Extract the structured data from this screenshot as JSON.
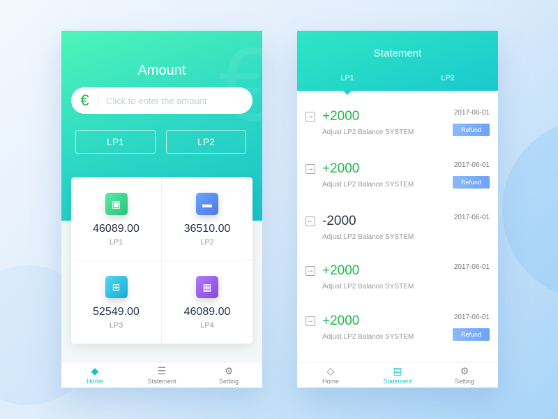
{
  "home": {
    "title": "Amount",
    "input_placeholder": "Click to enter the amount",
    "currency_symbol": "€",
    "buttons": [
      "LP1",
      "LP2"
    ],
    "accounts": [
      {
        "value": "46089.00",
        "label": "LP1"
      },
      {
        "value": "36510.00",
        "label": "LP2"
      },
      {
        "value": "52549.00",
        "label": "LP3"
      },
      {
        "value": "46089.00",
        "label": "LP4"
      }
    ]
  },
  "statement": {
    "title": "Statement",
    "tabs": [
      "LP1",
      "LP2"
    ],
    "rows": [
      {
        "amount": "+2000",
        "desc": "Adjust LP2 Balance SYSTEM",
        "date": "2017-06-01",
        "refund": "Refund"
      },
      {
        "amount": "+2000",
        "desc": "Adjust LP2 Balance SYSTEM",
        "date": "2017-06-01",
        "refund": "Refund"
      },
      {
        "amount": "-2000",
        "desc": "Adjust LP2 Balance SYSTEM",
        "date": "2017-06-01"
      },
      {
        "amount": "+2000",
        "desc": "Adjust LP2 Balance SYSTEM",
        "date": "2017-06-01"
      },
      {
        "amount": "+2000",
        "desc": "Adjust LP2 Balance SYSTEM",
        "date": "2017-06-01",
        "refund": "Refund"
      }
    ]
  },
  "nav": [
    "Home",
    "Statement",
    "Setting"
  ],
  "colors": {
    "accent": "#1cc4c0",
    "positive": "#1cba4e",
    "refund": "#7aaef8"
  }
}
